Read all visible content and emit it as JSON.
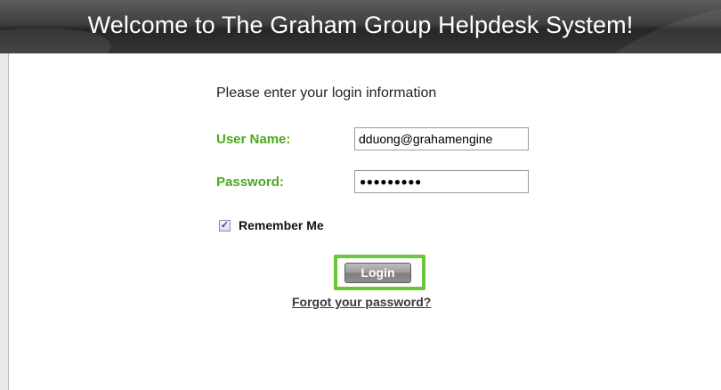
{
  "header": {
    "title": "Welcome to The Graham Group Helpdesk System!"
  },
  "form": {
    "intro": "Please enter your login information",
    "username_label": "User Name:",
    "username_value": "dduong@grahamengine",
    "password_label": "Password:",
    "password_dots": "●●●●●●●●●",
    "remember_label": "Remember Me",
    "remember_checked": true,
    "checkbox_glyph": "✓",
    "login_label": "Login",
    "forgot_label": "Forgot your password?"
  },
  "colors": {
    "label_green": "#4aa81e",
    "highlight_green": "#6cc53a",
    "header_dark": "#2f2f2f"
  }
}
